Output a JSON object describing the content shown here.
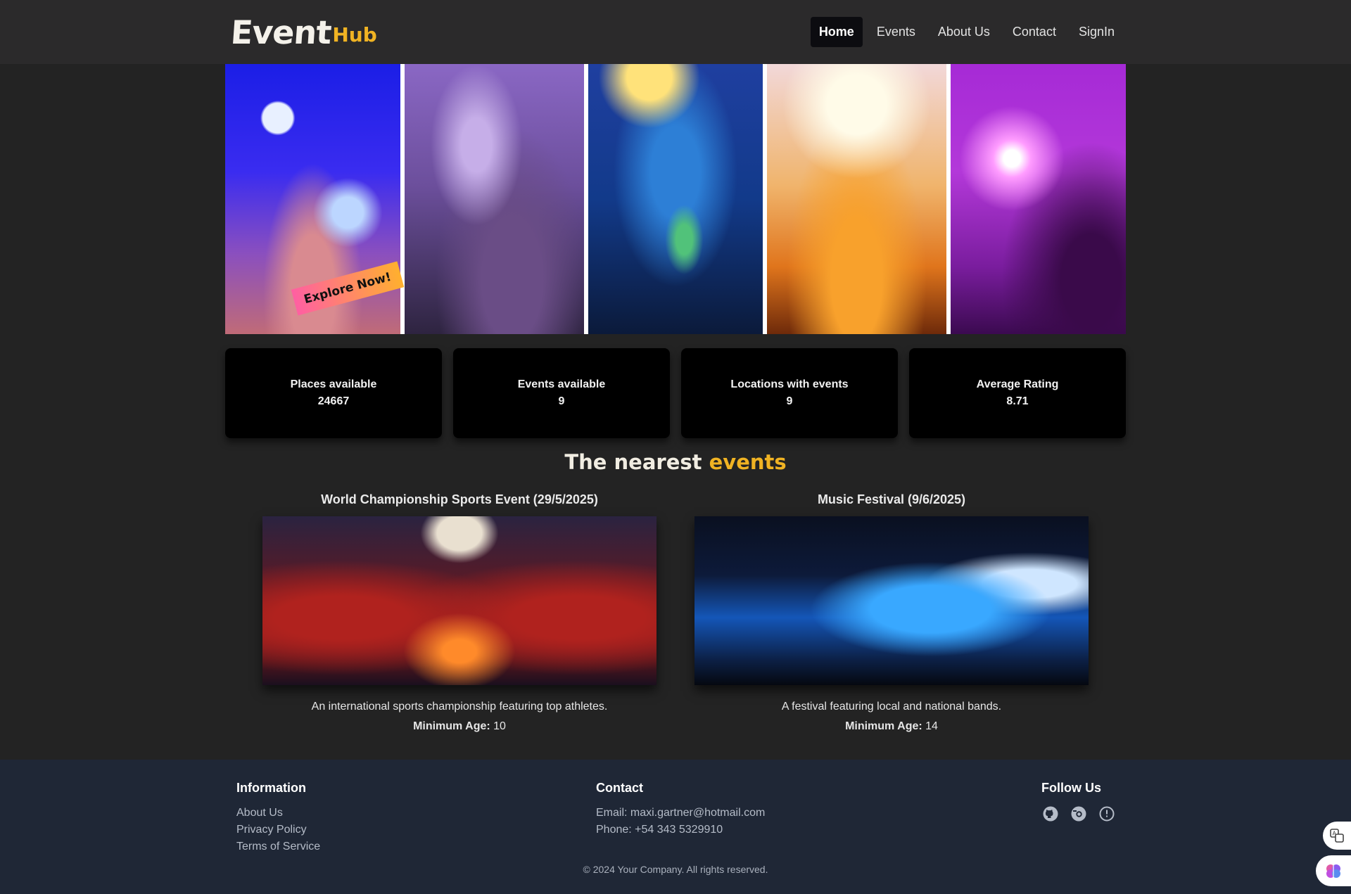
{
  "brand": {
    "part1": "Event",
    "part2": "Hub",
    "accent_color": "#f0b323"
  },
  "nav": {
    "items": [
      {
        "label": "Home",
        "active": true
      },
      {
        "label": "Events"
      },
      {
        "label": "About Us"
      },
      {
        "label": "Contact"
      },
      {
        "label": "SignIn"
      }
    ]
  },
  "hero": {
    "cta_label": "Explore Now!"
  },
  "stats": [
    {
      "label": "Places available",
      "value": "24667"
    },
    {
      "label": "Events available",
      "value": "9"
    },
    {
      "label": "Locations with events",
      "value": "9"
    },
    {
      "label": "Average Rating",
      "value": "8.71"
    }
  ],
  "nearest": {
    "title_part1": "The nearest",
    "title_part2": "events",
    "events": [
      {
        "title": "World Championship Sports Event (29/5/2025)",
        "description": "An international sports championship featuring top athletes.",
        "min_age_label": "Minimum Age:",
        "min_age": "10"
      },
      {
        "title": "Music Festival (9/6/2025)",
        "description": "A festival featuring local and national bands.",
        "min_age_label": "Minimum Age:",
        "min_age": "14"
      }
    ]
  },
  "footer": {
    "information": {
      "heading": "Information",
      "links": [
        "About Us",
        "Privacy Policy",
        "Terms of Service"
      ]
    },
    "contact": {
      "heading": "Contact",
      "email": "Email: maxi.gartner@hotmail.com",
      "phone": "Phone: +54 343 5329910"
    },
    "follow": {
      "heading": "Follow Us",
      "icons": [
        "github-icon",
        "instagram-icon",
        "info-icon"
      ]
    },
    "copyright": "© 2024 Your Company. All rights reserved."
  }
}
